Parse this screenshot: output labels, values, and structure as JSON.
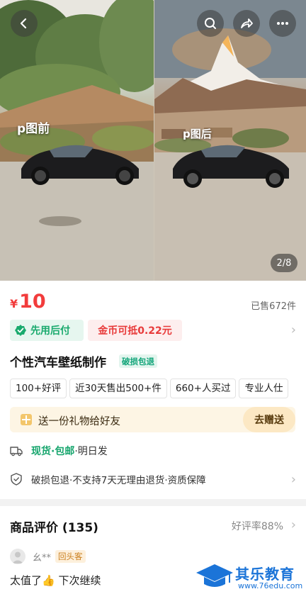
{
  "gallery": {
    "left_label": "p图前",
    "right_label": "p图后",
    "page_indicator": "2/8",
    "buttons": [
      "back-icon",
      "search-icon",
      "share-icon",
      "more-icon"
    ]
  },
  "product": {
    "currency": "¥",
    "price": "10",
    "sold": "已售672件",
    "pay_later": "先用后付",
    "coin_deduct": "金币可抵0.22元",
    "title": "个性汽车壁纸制作",
    "title_badge": "破损包退",
    "tags": [
      "100+好评",
      "近30天售出500+件",
      "660+人买过",
      "专业人仕"
    ]
  },
  "gift": {
    "text": "送一份礼物给好友",
    "button": "去赠送"
  },
  "shipping": {
    "highlight": "现货·包邮",
    "rest": "·明日发"
  },
  "guarantee": {
    "text": "破损包退·不支持7天无理由退货·资质保障"
  },
  "reviews": {
    "title": "商品评价 (135)",
    "rate": "好评率88%",
    "user": "幺**",
    "user_badge": "回头客",
    "text": "太值了👍 下次继续"
  },
  "watermark": {
    "cn": "其乐教育",
    "url": "www.76edu.com"
  },
  "colors": {
    "price_red": "#f23c3c",
    "green": "#16a56d",
    "brand_blue": "#1b74d8"
  }
}
